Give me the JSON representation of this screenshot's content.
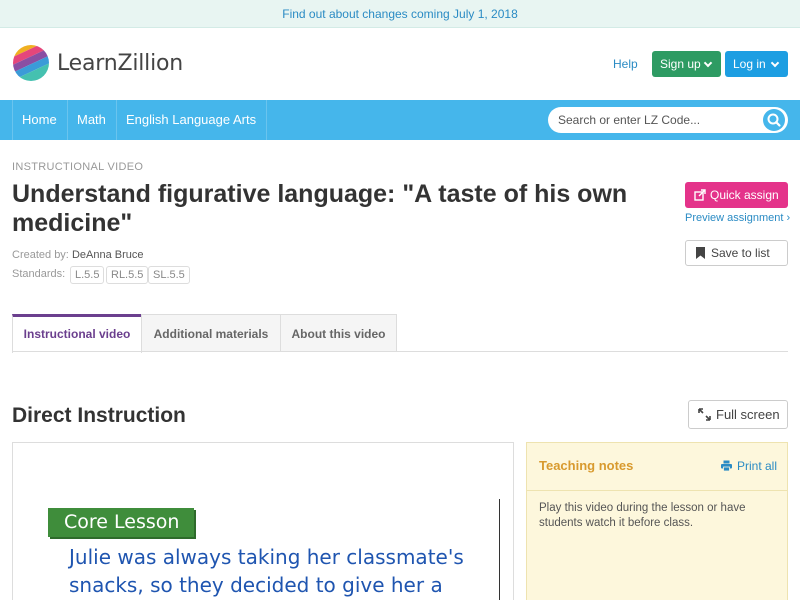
{
  "announcement": "Find out about changes coming July 1, 2018",
  "header": {
    "brand": "LearnZillion",
    "help": "Help",
    "signup": "Sign up",
    "login": "Log in"
  },
  "nav": {
    "items": [
      "Home",
      "Math",
      "English Language Arts"
    ],
    "search_placeholder": "Search or enter LZ Code..."
  },
  "lesson": {
    "kicker": "INSTRUCTIONAL VIDEO",
    "title": "Understand figurative language: \"A taste of his own medicine\"",
    "created_by_label": "Created by:",
    "author": "DeAnna Bruce",
    "standards_label": "Standards:",
    "standards": [
      "L.5.5",
      "RL.5.5",
      "SL.5.5"
    ]
  },
  "actions": {
    "quick_assign": "Quick assign",
    "preview": "Preview assignment ›",
    "save": "Save to list"
  },
  "tabs": [
    "Instructional video",
    "Additional materials",
    "About this video"
  ],
  "section": {
    "title": "Direct Instruction",
    "fullscreen": "Full screen"
  },
  "video": {
    "badge": "Core Lesson",
    "text": "Julie was always taking her classmate's snacks, so they decided to give her a taste"
  },
  "notes": {
    "title": "Teaching notes",
    "print": "Print all",
    "body": "Play this video during the lesson or have students watch it before class."
  },
  "colors": {
    "nav": "#45b6eb",
    "signup": "#2e9b63",
    "login": "#1d9ee2",
    "quick_assign": "#e4338a",
    "active_tab": "#6b3f8e",
    "notes_bg": "#fdf7dc"
  }
}
